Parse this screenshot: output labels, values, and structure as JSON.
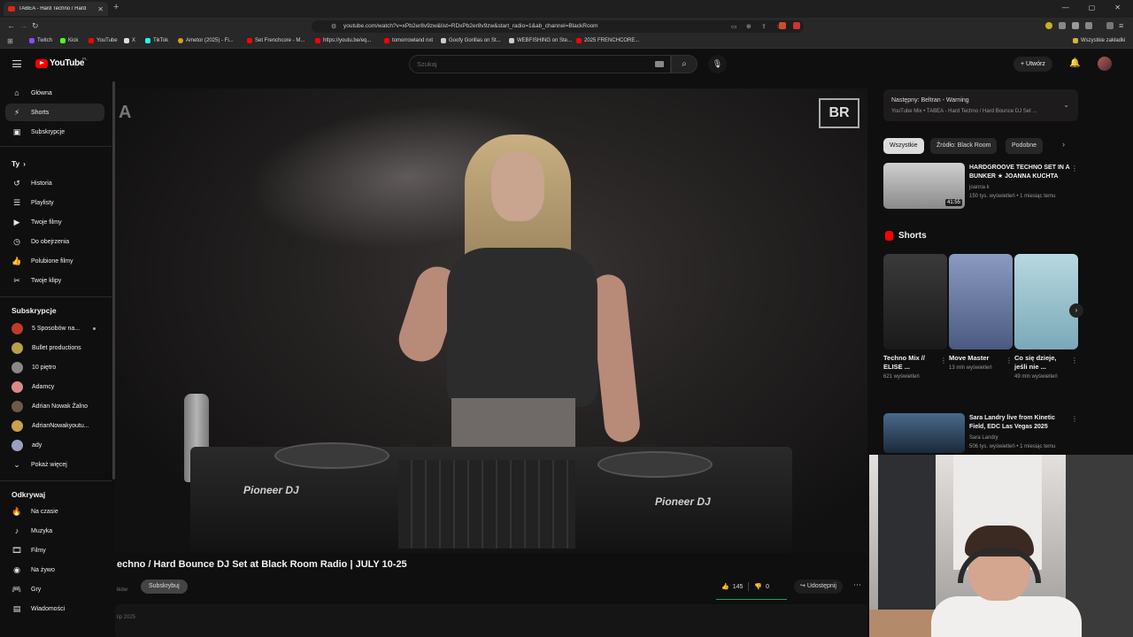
{
  "browser": {
    "tab_title": "TABEA - Hard Techno / Hard",
    "url": "youtube.com/watch?v=xPb2er8v9zw&list=RDxPb2er8v9zw&start_radio=1&ab_channel=BlackRoom",
    "bookmarks": [
      "Twitch",
      "Kick",
      "YouTube",
      "X",
      "TikTok",
      "Ametor (2025) - Fi...",
      "Set Frenchcore - M...",
      "https://youtu.be/eq...",
      "tomorrowland nxt",
      "Goofy Gorillas on St...",
      "WEBFISHING on Ste...",
      "2025 FRENCHCORE..."
    ],
    "bookmarks_all": "Wszystkie zakładki"
  },
  "masthead": {
    "logo": "YouTube",
    "country": "PL",
    "search_placeholder": "Szukaj",
    "create_label": "Utwórz"
  },
  "sidebar": {
    "main": [
      {
        "label": "Główna",
        "icon": "home-icon"
      },
      {
        "label": "Shorts",
        "icon": "shorts-icon"
      },
      {
        "label": "Subskrypcje",
        "icon": "subscriptions-icon"
      }
    ],
    "you_heading": "Ty",
    "you": [
      {
        "label": "Historia",
        "icon": "history-icon"
      },
      {
        "label": "Playlisty",
        "icon": "playlists-icon"
      },
      {
        "label": "Twoje filmy",
        "icon": "your-videos-icon"
      },
      {
        "label": "Do obejrzenia",
        "icon": "watch-later-icon"
      },
      {
        "label": "Polubione filmy",
        "icon": "liked-icon"
      },
      {
        "label": "Twoje klipy",
        "icon": "clips-icon"
      }
    ],
    "subs_heading": "Subskrypcje",
    "subs": [
      {
        "label": "5 Sposobów na...",
        "color": "#c0392b"
      },
      {
        "label": "Bullet productions",
        "color": "#b8a04a"
      },
      {
        "label": "10 piętro",
        "color": "#888888"
      },
      {
        "label": "Adamcy",
        "color": "#d88a8a"
      },
      {
        "label": "Adrian Nowak Żalno",
        "color": "#6a5a4a"
      },
      {
        "label": "AdrianNowakyoutu...",
        "color": "#c9a24a"
      },
      {
        "label": "ady",
        "color": "#9aa0c0"
      }
    ],
    "show_more": "Pokaż więcej",
    "explore_heading": "Odkrywaj",
    "explore": [
      {
        "label": "Na czasie",
        "icon": "trending-icon"
      },
      {
        "label": "Muzyka",
        "icon": "music-icon"
      },
      {
        "label": "Filmy",
        "icon": "movies-icon"
      },
      {
        "label": "Na żywo",
        "icon": "live-icon"
      },
      {
        "label": "Gry",
        "icon": "gaming-icon"
      },
      {
        "label": "Wiadomości",
        "icon": "news-icon"
      }
    ]
  },
  "video": {
    "overlay_letter": "A",
    "overlay_logo": "BR",
    "brand_left": "Pioneer DJ",
    "brand_right": "Pioneer DJ",
    "title": "echno / Hard Bounce DJ Set at Black Room Radio | JULY 10-25",
    "owner_fragment": "ików",
    "subscribe_label": "Subskrybuj",
    "likes": "145",
    "dislikes": "0",
    "share_label": "Udostępnij",
    "date_fragment": "lip 2025",
    "like_ratio": 1.0
  },
  "right": {
    "next_label": "Następny: Beltran - Warning",
    "next_sub": "YouTube Mix • TABEA - Hard Techno / Hard Bounce DJ Set ...",
    "chips": [
      "Wszystkie",
      "Źródło: Black Room",
      "Podobne"
    ],
    "rec1": {
      "title": "HARDGROOVE TECHNO SET IN A BUNKER ★ JOANNA KUCHTA",
      "channel": "joanna k",
      "meta": "150 tys. wyświetleń • 1 miesiąc temu",
      "duration": "41:55"
    },
    "shorts_heading": "Shorts",
    "shorts": [
      {
        "title": "Techno Mix // ELISE ...",
        "views": "621 wyświetleń",
        "color": "#2a2a2a"
      },
      {
        "title": "Move Master",
        "views": "13 mln wyświetleń",
        "color": "#6b7fb0"
      },
      {
        "title": "Co się dzieje, jeśli nie ...",
        "views": "49 mln wyświetleń",
        "color": "#9cc3d3"
      }
    ],
    "rec2": {
      "title": "Sara Landry live from Kinetic Field, EDC Las Vegas 2025",
      "channel": "Sara Landry",
      "meta": "506 tys. wyświetleń • 1 miesiąc temu"
    }
  }
}
